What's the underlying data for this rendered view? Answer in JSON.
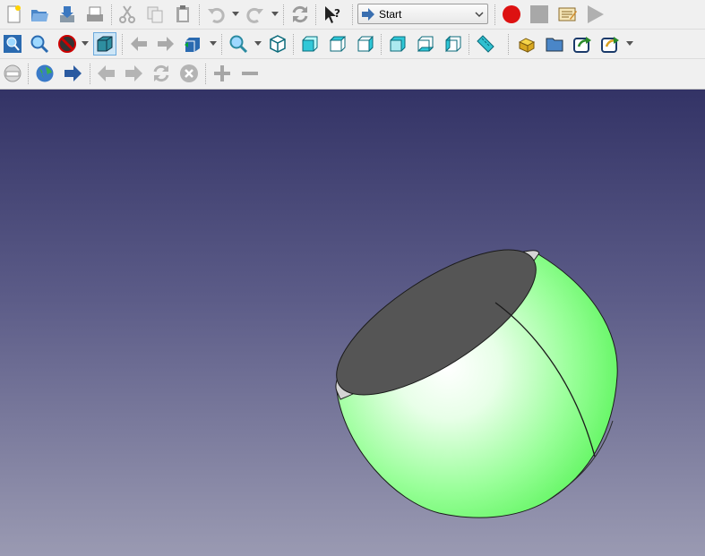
{
  "app": {
    "toolbars": {
      "file": [
        "new-document-icon",
        "open-folder-icon",
        "save-icon",
        "print-icon"
      ],
      "edit": [
        "cut-icon",
        "copy-icon",
        "paste-icon",
        "undo-icon",
        "redo-icon",
        "refresh-icon",
        "whats-this-icon"
      ],
      "workbench_selector": {
        "selected": "Start",
        "icon": "arrow-right-icon"
      },
      "macro": [
        "record-macro-icon",
        "stop-macro-icon",
        "edit-macro-icon",
        "play-macro-icon"
      ],
      "view": [
        "fit-all-icon",
        "fit-selection-icon",
        "draw-style-icon",
        "bounding-box-icon",
        "back-icon",
        "forward-icon",
        "sync-view-icon",
        "zoom-icon",
        "isometric-view-icon",
        "front-view-icon",
        "top-view-icon",
        "right-view-icon",
        "rear-view-icon",
        "bottom-view-icon",
        "left-view-icon",
        "measure-icon"
      ],
      "structure": [
        "part-icon",
        "group-icon",
        "link-icon",
        "link-actions-icon"
      ],
      "navigation": [
        "web-icon",
        "globe-icon",
        "go-icon",
        "nav-back-icon",
        "nav-forward-icon",
        "nav-refresh-icon",
        "nav-stop-icon",
        "zoom-in-icon",
        "zoom-out-icon"
      ]
    },
    "colors": {
      "viewport_top": "#333366",
      "viewport_bottom": "#9a9ab2",
      "shape_face": "#66ff66",
      "shape_inner": "#555555",
      "record": "#dd1111"
    }
  }
}
